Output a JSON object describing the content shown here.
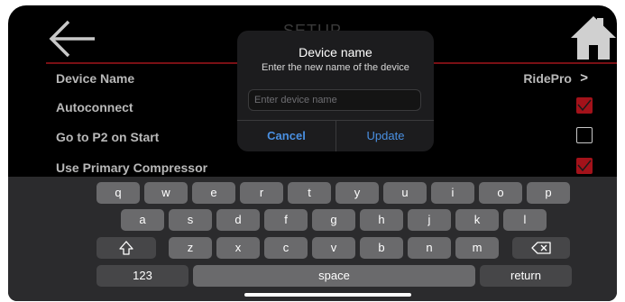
{
  "header": {
    "title": "SETUP",
    "back_icon": "arrow-left-icon",
    "home_icon": "house-icon"
  },
  "colors": {
    "accent_red": "#a3121a",
    "dialog_blue": "#4a90e2"
  },
  "settings": [
    {
      "label": "Device Name",
      "value": "RidePro",
      "chevron": ">"
    },
    {
      "label": "Autoconnect",
      "checked": true
    },
    {
      "label": "Go to P2 on Start",
      "checked": false
    },
    {
      "label": "Use Primary Compressor",
      "checked": true
    }
  ],
  "dialog": {
    "title": "Device name",
    "subtitle": "Enter the new name of the device",
    "input_placeholder": "Enter device name",
    "input_value": "",
    "cancel_label": "Cancel",
    "update_label": "Update"
  },
  "keyboard": {
    "row1": [
      "q",
      "w",
      "e",
      "r",
      "t",
      "y",
      "u",
      "i",
      "o",
      "p"
    ],
    "row2": [
      "a",
      "s",
      "d",
      "f",
      "g",
      "h",
      "j",
      "k",
      "l"
    ],
    "row3": [
      "z",
      "x",
      "c",
      "v",
      "b",
      "n",
      "m"
    ],
    "shift_icon": "shift-icon",
    "backspace_icon": "backspace-icon",
    "numbers_label": "123",
    "space_label": "space",
    "return_label": "return"
  }
}
